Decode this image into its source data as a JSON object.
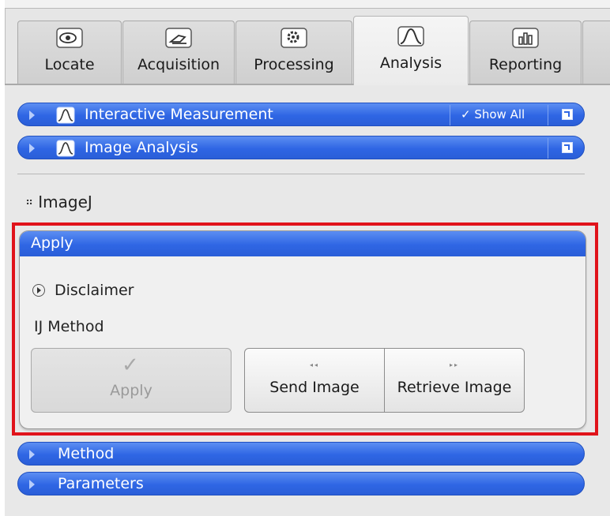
{
  "tabs": [
    {
      "label": "Locate",
      "icon": "eye-icon"
    },
    {
      "label": "Acquisition",
      "icon": "microscope-hand-icon"
    },
    {
      "label": "Processing",
      "icon": "gear-icon"
    },
    {
      "label": "Analysis",
      "icon": "peak-curve-icon",
      "active": true
    },
    {
      "label": "Reporting",
      "icon": "bar-chart-icon"
    }
  ],
  "tools": {
    "interactive_measurement": {
      "label": "Interactive Measurement",
      "show_all": "Show All"
    },
    "image_analysis": {
      "label": "Image Analysis"
    }
  },
  "section_title": "ImageJ",
  "apply_panel": {
    "header": "Apply",
    "disclaimer": "Disclaimer",
    "method_label": "IJ Method",
    "apply_button": "Apply",
    "send_button": "Send Image",
    "retrieve_button": "Retrieve Image"
  },
  "collapsed_sections": {
    "method": "Method",
    "parameters": "Parameters"
  },
  "colors": {
    "accent_blue": "#2f66e4",
    "highlight_red": "#e0131b"
  }
}
